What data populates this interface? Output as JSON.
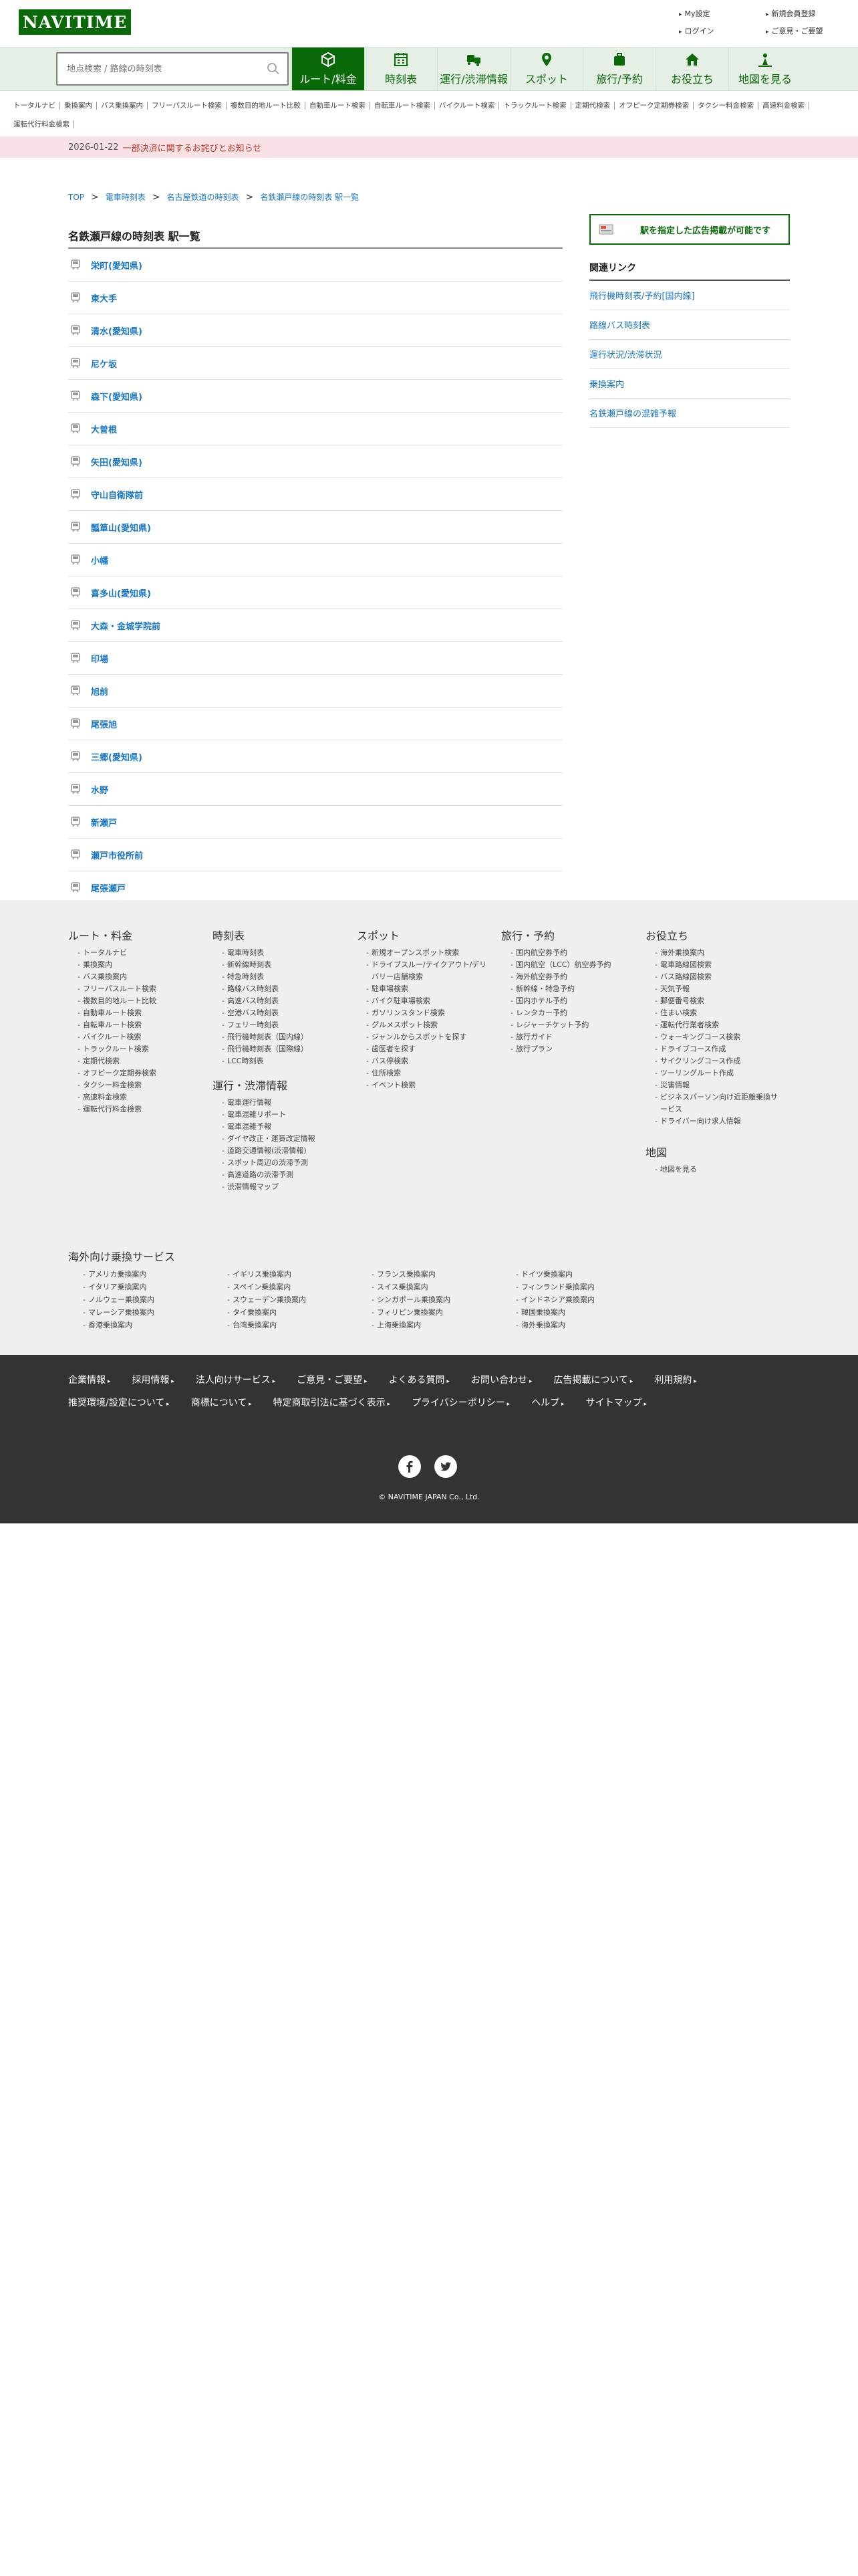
{
  "header": {
    "logo": "NAVITIME",
    "util_links": [
      "My設定",
      "新規会員登録",
      "ログイン",
      "ご意見・ご要望"
    ]
  },
  "search": {
    "placeholder": "地点検索 / 路線の時刻表"
  },
  "nav_tabs": [
    {
      "label": "ルート/料金",
      "icon": "cube-icon",
      "active": true
    },
    {
      "label": "時刻表",
      "icon": "calendar-icon"
    },
    {
      "label": "運行/渋滞情報",
      "icon": "traffic-icon"
    },
    {
      "label": "スポット",
      "icon": "pin-icon"
    },
    {
      "label": "旅行/予約",
      "icon": "suitcase-icon"
    },
    {
      "label": "お役立ち",
      "icon": "house-icon"
    },
    {
      "label": "地図を見る",
      "icon": "map-person-icon"
    }
  ],
  "sublinks": [
    "トータルナビ",
    "乗換案内",
    "バス乗換案内",
    "フリーパスルート検索",
    "複数目的地ルート比較",
    "自動車ルート検索",
    "自転車ルート検索",
    "バイクルート検索",
    "トラックルート検索",
    "定期代検索",
    "オフピーク定期券検索",
    "タクシー料金検索",
    "高速料金検索",
    "運転代行料金検索"
  ],
  "notice": {
    "date": "2026-01-22",
    "text": "一部決済に関するお詫びとお知らせ"
  },
  "breadcrumb": [
    "TOP",
    "電車時刻表",
    "名古屋鉄道の時刻表",
    "名鉄瀬戸線の時刻表 駅一覧"
  ],
  "page_title": "名鉄瀬戸線の時刻表 駅一覧",
  "stations": [
    "栄町(愛知県)",
    "東大手",
    "清水(愛知県)",
    "尼ケ坂",
    "森下(愛知県)",
    "大曽根",
    "矢田(愛知県)",
    "守山自衛隊前",
    "瓢箪山(愛知県)",
    "小幡",
    "喜多山(愛知県)",
    "大森・金城学院前",
    "印場",
    "旭前",
    "尾張旭",
    "三郷(愛知県)",
    "水野",
    "新瀬戸",
    "瀬戸市役所前",
    "尾張瀬戸"
  ],
  "side": {
    "ad_button": "駅を指定した広告掲載が可能です",
    "related_title": "関連リンク",
    "related": [
      "飛行機時刻表/予約[国内線]",
      "路線バス時刻表",
      "運行状況/渋滞状況",
      "乗換案内",
      "名鉄瀬戸線の混雑予報"
    ]
  },
  "sitemap": {
    "route": {
      "title": "ルート・料金",
      "items": [
        "トータルナビ",
        "乗換案内",
        "バス乗換案内",
        "フリーパスルート検索",
        "複数目的地ルート比較",
        "自動車ルート検索",
        "自転車ルート検索",
        "バイクルート検索",
        "トラックルート検索",
        "定期代検索",
        "オフピーク定期券検索",
        "タクシー料金検索",
        "高速料金検索",
        "運転代行料金検索"
      ]
    },
    "timetable": {
      "title": "時刻表",
      "items": [
        "電車時刻表",
        "新幹線時刻表",
        "特急時刻表",
        "路線バス時刻表",
        "高速バス時刻表",
        "空港バス時刻表",
        "フェリー時刻表",
        "飛行機時刻表（国内線）",
        "飛行機時刻表（国際線）",
        "LCC時刻表"
      ]
    },
    "traffic": {
      "title": "運行・渋滞情報",
      "items": [
        "電車運行情報",
        "電車混雑リポート",
        "電車混雑予報",
        "ダイヤ改正・運賃改定情報",
        "道路交通情報(渋滞情報)",
        "スポット周辺の渋滞予測",
        "高速道路の渋滞予測",
        "渋滞情報マップ"
      ]
    },
    "spot": {
      "title": "スポット",
      "items": [
        "新規オープンスポット検索",
        "ドライブスルー/テイクアウト/デリバリー店舗検索",
        "駐車場検索",
        "バイク駐車場検索",
        "ガソリンスタンド検索",
        "グルメスポット検索",
        "ジャンルからスポットを探す",
        "歯医者を探す",
        "バス停検索",
        "住所検索",
        "イベント検索"
      ]
    },
    "travel": {
      "title": "旅行・予約",
      "items": [
        "国内航空券予約",
        "国内航空（LCC）航空券予約",
        "海外航空券予約",
        "新幹線・特急予約",
        "国内ホテル予約",
        "レンタカー予約",
        "レジャーチケット予約",
        "旅行ガイド",
        "旅行プラン"
      ]
    },
    "useful": {
      "title": "お役立ち",
      "items": [
        "海外乗換案内",
        "電車路線図検索",
        "バス路線図検索",
        "天気予報",
        "郵便番号検索",
        "住まい検索",
        "運転代行業者検索",
        "ウォーキングコース検索",
        "ドライブコース作成",
        "サイクリングコース作成",
        "ツーリングルート作成",
        "災害情報",
        "ビジネスパーソン向け近距離乗換サービス",
        "ドライバー向け求人情報"
      ]
    },
    "map": {
      "title": "地図",
      "items": [
        "地図を見る"
      ]
    }
  },
  "overseas": {
    "title": "海外向け乗換サービス",
    "items": [
      "アメリカ乗換案内",
      "イギリス乗換案内",
      "フランス乗換案内",
      "ドイツ乗換案内",
      "イタリア乗換案内",
      "スペイン乗換案内",
      "スイス乗換案内",
      "フィンランド乗換案内",
      "ノルウェー乗換案内",
      "スウェーデン乗換案内",
      "シンガポール乗換案内",
      "インドネシア乗換案内",
      "マレーシア乗換案内",
      "タイ乗換案内",
      "フィリピン乗換案内",
      "韓国乗換案内",
      "香港乗換案内",
      "台湾乗換案内",
      "上海乗換案内",
      "海外乗換案内"
    ]
  },
  "footer": {
    "links": [
      "企業情報",
      "採用情報",
      "法人向けサービス",
      "ご意見・ご要望",
      "よくある質問",
      "お問い合わせ",
      "広告掲載について",
      "利用規約",
      "推奨環境/設定について",
      "商標について",
      "特定商取引法に基づく表示",
      "プライバシーポリシー",
      "ヘルプ",
      "サイトマップ"
    ],
    "copyright": "© NAVITIME JAPAN Co., Ltd."
  },
  "colors": {
    "brand": "#0a6a0a",
    "link": "#1a77c4",
    "notice_bg": "#f7e1e4",
    "footer_dark": "#333333"
  }
}
